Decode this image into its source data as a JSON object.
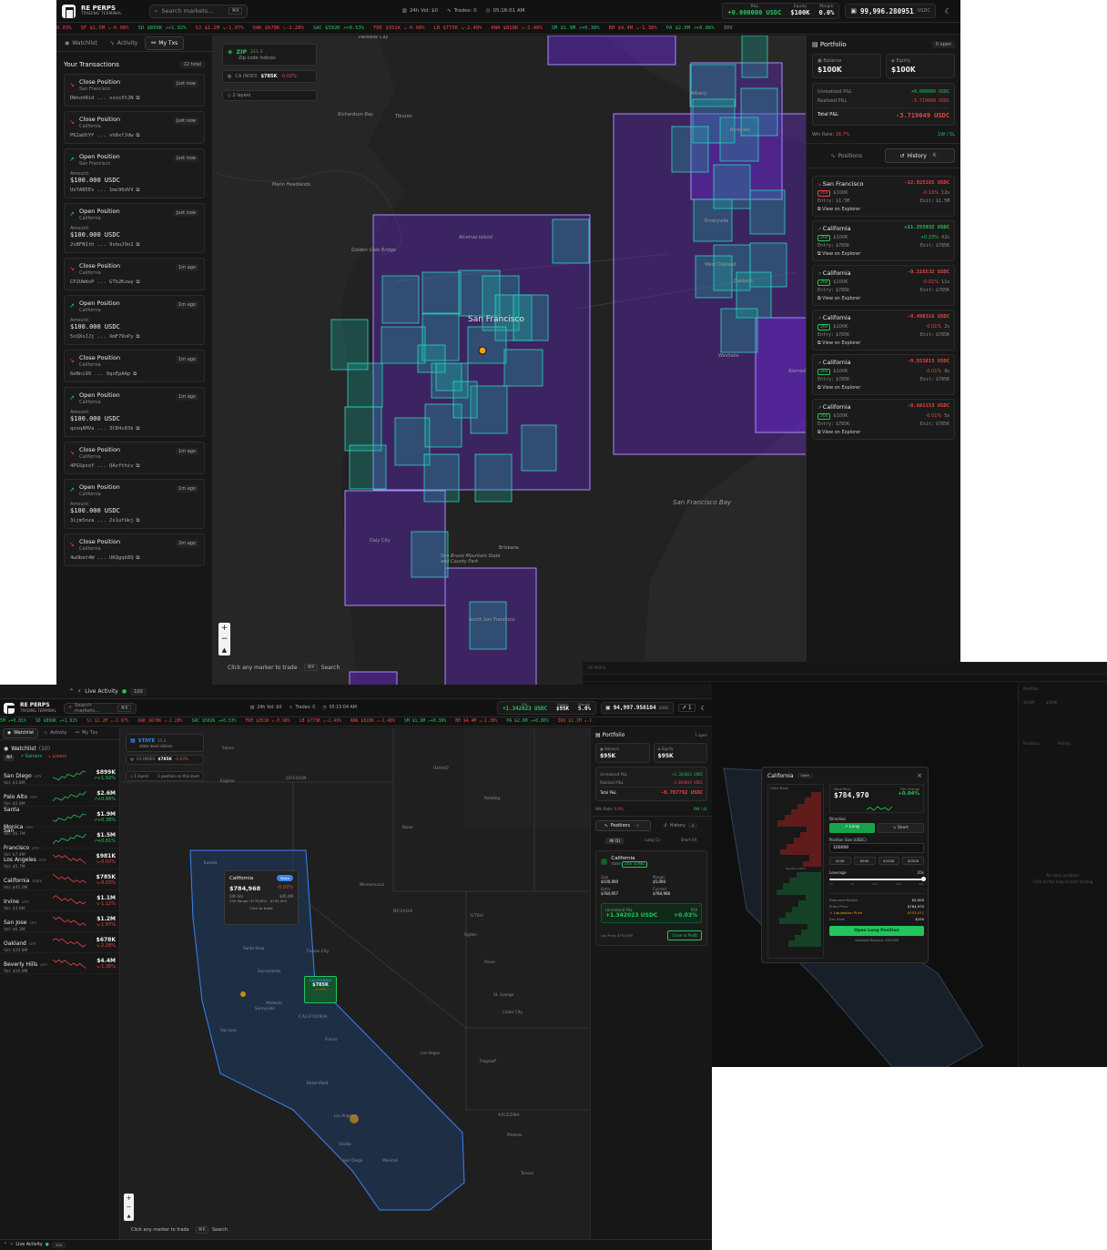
{
  "brand": {
    "name": "RE PERPS",
    "tagline": "TRADING TERMINAL"
  },
  "search": {
    "placeholder": "Search markets...",
    "shortcut": "⌘K"
  },
  "win1": {
    "stats": {
      "vol": "24h Vol: $0",
      "trades": "Trades: 0",
      "time": "05:16:01 AM"
    },
    "pnl": {
      "label": "P&L",
      "value": "+0.000000 USDC"
    },
    "equity": {
      "label": "Equity",
      "value": "$100K"
    },
    "margin": {
      "label": "Margin",
      "value": "0.0%"
    },
    "wallet": {
      "value": "99,996.280951",
      "unit": "USDC"
    },
    "ticker": [
      {
        "t": "0.03%",
        "c": "r"
      },
      {
        "t": "SF $1.5M ↘-0.08%",
        "c": "r"
      },
      {
        "t": "SD $899K ↗+1.92%",
        "c": "g"
      },
      {
        "t": "SJ $1.2M ↘-1.97%",
        "c": "r"
      },
      {
        "t": "OAK $678K ↘-2.28%",
        "c": "r"
      },
      {
        "t": "SAC $502K ↗+0.53%",
        "c": "g"
      },
      {
        "t": "FRE $351K ↘-0.98%",
        "c": "r"
      },
      {
        "t": "LB $773K ↘-2.49%",
        "c": "r"
      },
      {
        "t": "ANA $818K ↘-2.48%",
        "c": "r"
      },
      {
        "t": "SM $1.9M ↗+0.38%",
        "c": "g"
      },
      {
        "t": "BH $4.4M ↘-1.38%",
        "c": "r"
      },
      {
        "t": "PA $2.6M ↗+0.86%",
        "c": "g"
      },
      {
        "t": "IRV",
        "c": "m"
      }
    ],
    "tabs": [
      "Watchlist",
      "Activity",
      "My Txs"
    ],
    "tx_title": "Your Transactions",
    "tx_count": "12 total",
    "amount_label": "Amount:",
    "txs": [
      {
        "title": "Close Position",
        "sub": "San Francisco",
        "time": "Just now",
        "hash": "DWsohRid ... vsxcXtJN",
        "amount": "",
        "dir": "down"
      },
      {
        "title": "Close Position",
        "sub": "California",
        "time": "Just now",
        "hash": "P62aUtYf ... vh8xfJdw",
        "amount": "",
        "dir": "down"
      },
      {
        "title": "Open Position",
        "sub": "San Francisco",
        "time": "Just now",
        "hash": "UxYAB5Ev ... 1mc96dVV",
        "amount": "$100.000 USDC",
        "dir": "up"
      },
      {
        "title": "Open Position",
        "sub": "California",
        "time": "Just now",
        "hash": "2vBFN1th ... 9vbuJ9o1",
        "amount": "$100.000 USDC",
        "dir": "up"
      },
      {
        "title": "Close Position",
        "sub": "California",
        "time": "1m ago",
        "hash": "CP2UWdxP ... GTb2Kzwy",
        "amount": "",
        "dir": "down"
      },
      {
        "title": "Open Position",
        "sub": "California",
        "time": "1m ago",
        "hash": "5xQXxJJj ... XmF79oPy",
        "amount": "$100.000 USDC",
        "dir": "up"
      },
      {
        "title": "Close Position",
        "sub": "California",
        "time": "1m ago",
        "hash": "6eBni99 ... 9qxEpAAp",
        "amount": "",
        "dir": "down"
      },
      {
        "title": "Open Position",
        "sub": "California",
        "time": "1m ago",
        "hash": "qzoqAMVa ... 3CB4s83k",
        "amount": "$100.000 USDC",
        "dir": "up"
      },
      {
        "title": "Close Position",
        "sub": "California",
        "time": "1m ago",
        "hash": "4PGSpxoY ... QAzfthiv",
        "amount": "",
        "dir": "down"
      },
      {
        "title": "Open Position",
        "sub": "California",
        "time": "1m ago",
        "hash": "3ijm5nza ... Zs1ufUej",
        "amount": "$100.000 USDC",
        "dir": "up"
      },
      {
        "title": "Close Position",
        "sub": "California",
        "time": "2m ago",
        "hash": "4wUbet4W ... UKQgqk8Q",
        "amount": "",
        "dir": "down"
      }
    ],
    "layer": {
      "name": "ZIP",
      "count": "211.3",
      "desc": "Zip code indices",
      "index_label": "CA INDEX",
      "index_val": "$785K",
      "index_chg": "-0.02%",
      "layers": "2 layers"
    },
    "map_labels": [
      "Paradise Cay",
      "Richardson Bay",
      "Tiburon",
      "Marin Headlands",
      "Golden Gate Bridge",
      "Alcatraz Island",
      "San Francisco",
      "Daly City",
      "Brisbane",
      "South San Francisco",
      "San Francisco Bay",
      "Albany",
      "Berkeley",
      "Emeryville",
      "Oakland",
      "Alameda",
      "San Bruno Mountain State and County Park",
      "West Oakland",
      "Westlake"
    ],
    "hint": "Click any marker to trade",
    "hint_key": "⌘K",
    "hint_search": "Search",
    "portfolio": {
      "title": "Portfolio",
      "open": "0 open",
      "balance_label": "Balance",
      "balance": "$100K",
      "equity_label": "Equity",
      "equity": "$100K",
      "upnl_label": "Unrealized P&L",
      "upnl": "+0.000000 USDC",
      "rpnl_label": "Realized P&L",
      "rpnl": "-3.719049 USDC",
      "tpnl_label": "Total P&L",
      "tpnl": "-3.719049 USDC",
      "winrate_label": "Win Rate:",
      "winrate": "16.7%",
      "wl": "1W / 5L",
      "positions_tab": "Positions",
      "history_tab": "History",
      "history_count": "6",
      "entry_label": "Entry:",
      "exit_label": "Exit:",
      "explorer": "View on Explorer",
      "history": [
        {
          "name": "San Francisco",
          "pnl": "-12.925165 USDC",
          "lev": "20x",
          "size": "$100K",
          "pct": "-0.16%",
          "dur": "12s",
          "entry": "$1.5M",
          "exit": "$1.5M",
          "dir": "down"
        },
        {
          "name": "California",
          "pnl": "+11.255932 USDC",
          "lev": "20x",
          "size": "$100K",
          "pct": "+0.23%",
          "dur": "42s",
          "entry": "$785K",
          "exit": "$785K",
          "dir": "up"
        },
        {
          "name": "California",
          "pnl": "-0.316532 USDC",
          "lev": "20x",
          "size": "$100K",
          "pct": "-0.01%",
          "dur": "11s",
          "entry": "$785K",
          "exit": "$785K",
          "dir": "up"
        },
        {
          "name": "California",
          "pnl": "-0.498316 USDC",
          "lev": "20x",
          "size": "$100K",
          "pct": "-0.01%",
          "dur": "2s",
          "entry": "$785K",
          "exit": "$785K",
          "dir": "up"
        },
        {
          "name": "California",
          "pnl": "-0.553813 USDC",
          "lev": "20x",
          "size": "$100K",
          "pct": "-0.01%",
          "dur": "9s",
          "entry": "$785K",
          "exit": "$785K",
          "dir": "up"
        },
        {
          "name": "California",
          "pnl": "-0.681153 USDC",
          "lev": "20x",
          "size": "$100K",
          "pct": "-0.01%",
          "dur": "5s",
          "entry": "$785K",
          "exit": "$785K",
          "dir": "up"
        }
      ]
    }
  },
  "win2": {
    "stats": {
      "vol": "24h Vol: $0",
      "trades": "Trades: 0",
      "time": "05:15:04 AM"
    },
    "pnl": {
      "label": "P&L",
      "value": "+1.342023 USDC"
    },
    "equity": {
      "label": "Equity",
      "value": "$95K"
    },
    "margin": {
      "label": "Margin",
      "value": "5.0%"
    },
    "wallet": {
      "value": "94,997.958184",
      "unit": "USDC"
    },
    "ticker": [
      {
        "t": "5M ↗+0.81%",
        "c": "g"
      },
      {
        "t": "SD $899K ↗+1.92%",
        "c": "g"
      },
      {
        "t": "SJ $1.2M ↘-1.97%",
        "c": "r"
      },
      {
        "t": "OAK $678K ↘-2.28%",
        "c": "r"
      },
      {
        "t": "SAC $502K ↗+0.53%",
        "c": "g"
      },
      {
        "t": "FRE $351K ↘-0.98%",
        "c": "r"
      },
      {
        "t": "LB $773K ↘-2.49%",
        "c": "r"
      },
      {
        "t": "ANA $818K ↘-2.48%",
        "c": "r"
      },
      {
        "t": "SM $1.9M ↗+0.38%",
        "c": "g"
      },
      {
        "t": "BH $4.4M ↘-1.38%",
        "c": "r"
      },
      {
        "t": "PA $2.6M ↗+0.86%",
        "c": "g"
      },
      {
        "t": "IRV $1.1M ↘-1.",
        "c": "r"
      }
    ],
    "live": {
      "label": "Live Activity",
      "count": "100"
    },
    "watchlist": {
      "title": "Watchlist",
      "count": "(10)",
      "filters": [
        "All",
        "Gainers",
        "Losers"
      ],
      "items": [
        {
          "name": "San Diego",
          "type": "CITY",
          "vol": "Vol: $3.8M",
          "price": "$899K",
          "chg": "↗+1.92%",
          "c": "g"
        },
        {
          "name": "Palo Alto",
          "type": "CITY",
          "vol": "Vol: $5.8M",
          "price": "$2.6M",
          "chg": "↗+0.86%",
          "c": "g"
        },
        {
          "name": "Santa Monica",
          "type": "CITY",
          "vol": "Vol: $6.7M",
          "price": "$1.9M",
          "chg": "↗+0.38%",
          "c": "g"
        },
        {
          "name": "San Francisco",
          "type": "CITY",
          "vol": "Vol: $7.4M",
          "price": "$1.5M",
          "chg": "↗+0.81%",
          "c": "g"
        },
        {
          "name": "Los Angeles",
          "type": "CITY",
          "vol": "Vol: $5.7M",
          "price": "$981K",
          "chg": "↘-0.02%",
          "c": "r"
        },
        {
          "name": "California",
          "type": "STATE",
          "vol": "Vol: $45.0M",
          "price": "$785K",
          "chg": "↘-0.03%",
          "c": "r"
        },
        {
          "name": "Irvine",
          "type": "CITY",
          "vol": "Vol: $3.6M",
          "price": "$1.1M",
          "chg": "↘-1.12%",
          "c": "r"
        },
        {
          "name": "San Jose",
          "type": "CITY",
          "vol": "Vol: $6.3M",
          "price": "$1.2M",
          "chg": "↘-1.97%",
          "c": "r"
        },
        {
          "name": "Oakland",
          "type": "CITY",
          "vol": "Vol: $10.8M",
          "price": "$678K",
          "chg": "↘-2.28%",
          "c": "r"
        },
        {
          "name": "Beverly Hills",
          "type": "CITY",
          "vol": "Vol: $10.9M",
          "price": "$4.4M",
          "chg": "↘-1.38%",
          "c": "r"
        }
      ]
    },
    "layer": {
      "name": "STATE",
      "count": "15.3",
      "desc": "state-level indices",
      "index_label": "CA INDEX",
      "index_val": "$785K",
      "index_chg": "-0.03%",
      "layers": "1 layers",
      "note": "1 position on this level"
    },
    "popup": {
      "name": "California",
      "badge": "State",
      "price": "$784,968",
      "chg": "-0.03%",
      "vol": "24h Vol",
      "vol_val": "$45.0M",
      "range": "24h Range: $776,800 - $795,000",
      "click": "Click to trade"
    },
    "marker": {
      "name": "CALIFORNIA",
      "price": "$785K",
      "chg": "-0.03%"
    },
    "map_labels": [
      "Salem",
      "Eugene",
      "OREGON",
      "IDAHO",
      "Boise",
      "Redding",
      "Eureka",
      "Reno",
      "Winnemucca",
      "NEVADA",
      "UTAH",
      "Ogden",
      "Provo",
      "Sacramento",
      "Sunnyvale",
      "Fresno",
      "CALIFORNIA",
      "Las Vegas",
      "St. George",
      "Bakersfield",
      "Los Angeles",
      "San Diego",
      "Mexicali",
      "ARIZONA",
      "Phoenix",
      "Tucson",
      "Flagstaff",
      "Carson City",
      "Modesto",
      "San Jose",
      "Santa Rosa",
      "Visalia",
      "Cedar City"
    ],
    "hint": "Click any marker to trade",
    "hint_key": "⌘K",
    "hint_search": "Search",
    "portfolio": {
      "title": "Portfolio",
      "open": "1 open",
      "balance_label": "Balance",
      "balance": "$95K",
      "equity_label": "Equity",
      "equity": "$95K",
      "upnl_label": "Unrealized P&L",
      "upnl": "+1.342023 USDC",
      "rpnl_label": "Realized P&L",
      "rpnl": "-2.045819 USDC",
      "tpnl_label": "Total P&L",
      "tpnl": "-0.787792 USDC",
      "winrate_label": "Win Rate:",
      "winrate": "0.0%",
      "wl": "0W / 4L",
      "positions_tab": "Positions",
      "positions_count": "1",
      "history_tab": "History",
      "history_count": "4",
      "subtabs": [
        "All (1)",
        "Long (1)",
        "Short (0)"
      ],
      "position": {
        "name": "California",
        "type": "state",
        "lev": "20x LONG",
        "size_label": "Size",
        "size": "$100,000",
        "margin_label": "Margin",
        "margin": "$5,000",
        "entry_label": "Entry",
        "entry": "$784,957",
        "current_label": "Current",
        "current": "$784,968",
        "upnl_label": "Unrealized P&L",
        "upnl": "+1.342023 USDC",
        "roi_label": "ROI",
        "roi": "+0.03%",
        "liq": "Liq. Price: $753,559",
        "close": "Close in Profit"
      }
    }
  },
  "win3": {
    "modal": {
      "title": "California",
      "badge": "State",
      "ob_header": "Order Book",
      "mark_label": "Mark Price",
      "price": "$784,970",
      "chg_label": "24h Change",
      "chg": "+0.04%",
      "dir_label": "Direction",
      "long": "Long",
      "short": "Short",
      "size_label": "Position Size (USDC)",
      "size_val": "100000",
      "quick": [
        "$10K",
        "$50K",
        "$100K",
        "$250K"
      ],
      "lev_label": "Leverage",
      "lev_val": "20x",
      "lev_marks": [
        "1x",
        "5x",
        "10x",
        "15x",
        "20x"
      ],
      "req_margin_label": "Required Margin",
      "req_margin": "$5,000",
      "entry_label": "Entry Price",
      "entry": "$784,970",
      "liq_label": "Liquidation Price",
      "liq": "$753,571",
      "fee_label": "Est. Fees",
      "fee": "$100",
      "open_btn": "Open Long Position",
      "avail": "Available Balance: $99,996",
      "spread": "Spread: 0.00%"
    },
    "portfolio": {
      "title": "Portfolio",
      "open": "0 open",
      "balance": "$100K",
      "equity": "$100K",
      "positions_tab": "Positions",
      "history_tab": "History",
      "subtabs": [
        "All (0)",
        "Long (0)",
        "Short (0)"
      ],
      "empty": "No open positions",
      "empty_sub": "Click on the map to start trading"
    }
  },
  "colors": {
    "accent": "#22c55e",
    "down": "#ef4444",
    "purple": "#8b5cf6",
    "teal": "#2dd4bf",
    "blue": "#3b82f6"
  }
}
